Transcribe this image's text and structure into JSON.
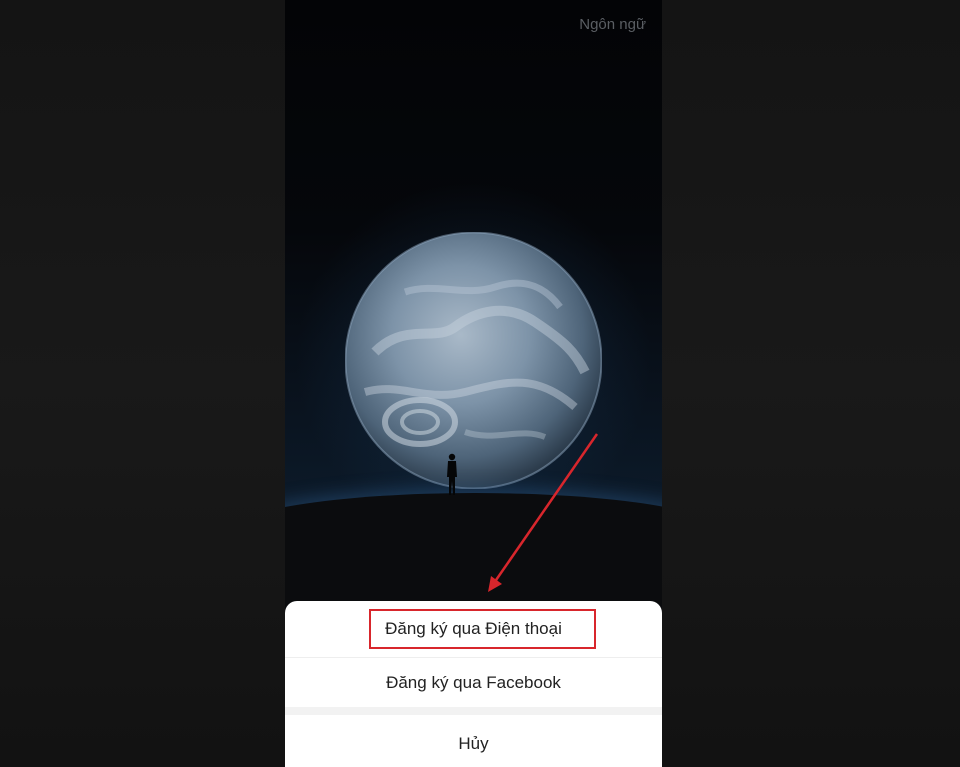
{
  "header": {
    "language_link": "Ngôn ngữ"
  },
  "sheet": {
    "options": [
      {
        "label": "Đăng ký qua Điện thoại"
      },
      {
        "label": "Đăng ký qua Facebook"
      }
    ],
    "cancel_label": "Hủy"
  },
  "annotation": {
    "highlight_color": "#d8262c",
    "arrow_color": "#d8262c"
  },
  "icons": {
    "planet": "earth-icon",
    "figure": "person-silhouette-icon"
  }
}
